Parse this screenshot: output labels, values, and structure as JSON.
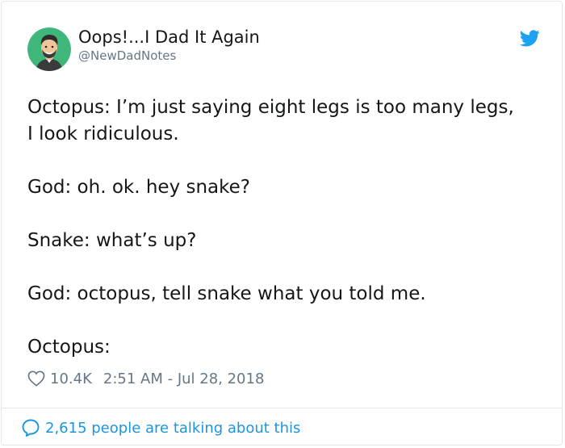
{
  "author": {
    "name": "Oops!...I Dad It Again",
    "handle": "@NewDadNotes"
  },
  "tweet": {
    "lines": [
      "Octopus: I’m just saying eight legs is too many legs,",
      "I look ridiculous.",
      "God: oh. ok. hey snake?",
      "Snake: what’s up?",
      "God: octopus, tell snake what you told me.",
      "Octopus:"
    ]
  },
  "meta": {
    "likes": "10.4K",
    "timestamp": "2:51 AM - Jul 28, 2018"
  },
  "footer": {
    "conversation_text": "2,615 people are talking about this"
  },
  "icons": {
    "brand": "twitter-bird-icon",
    "like": "heart-icon",
    "conversation": "speech-bubble-icon"
  },
  "colors": {
    "twitter_blue": "#1da1f2",
    "link_blue": "#1b95e0",
    "secondary_text": "#657786",
    "primary_text": "#14171a",
    "avatar_background": "#3fb67a"
  }
}
